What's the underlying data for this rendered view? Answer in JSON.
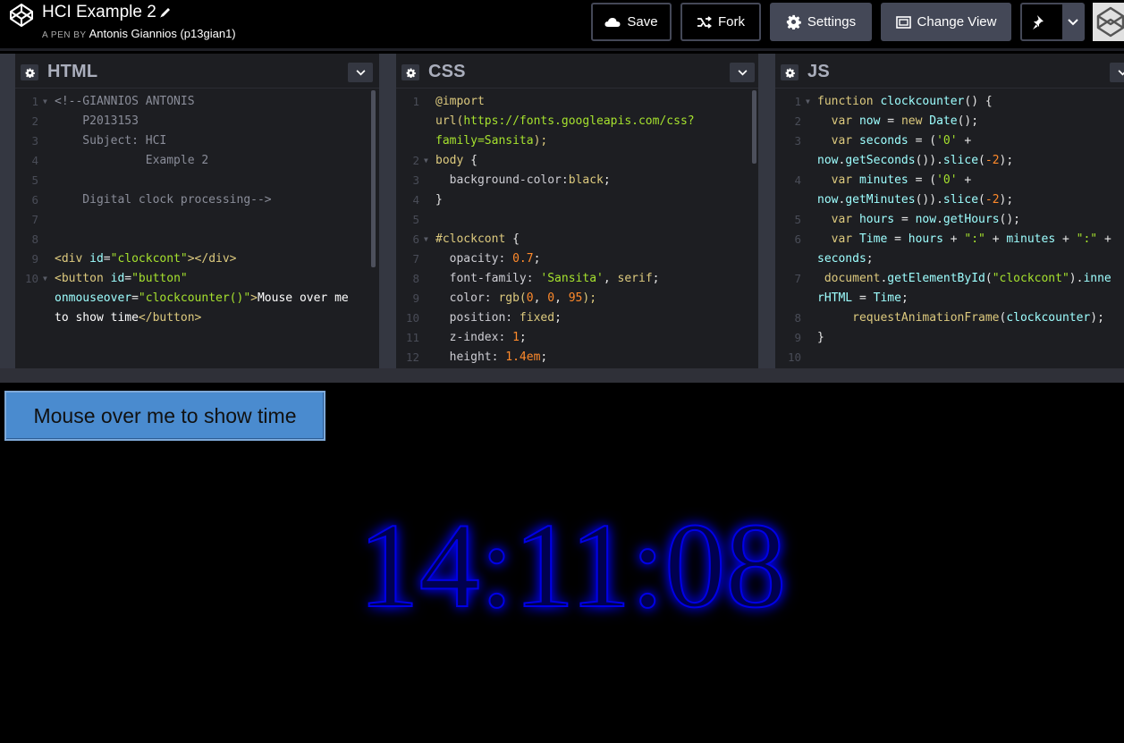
{
  "header": {
    "title": "HCI Example 2",
    "byline_prefix": "A PEN BY",
    "author": "Antonis Giannios (p13gian1)",
    "buttons": {
      "save": "Save",
      "fork": "Fork",
      "settings": "Settings",
      "change_view": "Change View"
    }
  },
  "editors": {
    "html": {
      "title": "HTML",
      "lines": [
        {
          "n": "1",
          "fold": true,
          "segments": [
            {
              "t": "<!--GIANNIOS ANTONIS",
              "c": "#8a8d99"
            }
          ]
        },
        {
          "n": "2",
          "segments": [
            {
              "t": "    P2013153",
              "c": "#8a8d99"
            }
          ]
        },
        {
          "n": "3",
          "segments": [
            {
              "t": "    Subject: HCI",
              "c": "#8a8d99"
            }
          ]
        },
        {
          "n": "4",
          "segments": [
            {
              "t": "             Example 2",
              "c": "#8a8d99"
            }
          ]
        },
        {
          "n": "5",
          "segments": [
            {
              "t": "",
              "c": "#8a8d99"
            }
          ]
        },
        {
          "n": "6",
          "segments": [
            {
              "t": "    Digital clock processing-->",
              "c": "#8a8d99"
            }
          ]
        },
        {
          "n": "7",
          "segments": []
        },
        {
          "n": "8",
          "segments": []
        },
        {
          "n": "9",
          "segments": [
            {
              "t": "<div ",
              "c": "#ddca7e"
            },
            {
              "t": "id",
              "c": "#9effff"
            },
            {
              "t": "=",
              "c": "#e6e6e6"
            },
            {
              "t": "\"clockcont\"",
              "c": "#a6e22e"
            },
            {
              "t": "></div>",
              "c": "#ddca7e"
            }
          ]
        },
        {
          "n": "10",
          "fold": true,
          "segments": [
            {
              "t": "<button ",
              "c": "#ddca7e"
            },
            {
              "t": "id",
              "c": "#9effff"
            },
            {
              "t": "=",
              "c": "#e6e6e6"
            },
            {
              "t": "\"button\"",
              "c": "#a6e22e"
            }
          ]
        },
        {
          "n": "",
          "segments": [
            {
              "t": "onmouseover",
              "c": "#9effff"
            },
            {
              "t": "=",
              "c": "#e6e6e6"
            },
            {
              "t": "\"clockcounter()\"",
              "c": "#a6e22e"
            },
            {
              "t": ">",
              "c": "#ddca7e"
            },
            {
              "t": "Mouse over me",
              "c": "#ffffff"
            }
          ]
        },
        {
          "n": "",
          "segments": [
            {
              "t": "to show time",
              "c": "#ffffff"
            },
            {
              "t": "</button>",
              "c": "#ddca7e"
            }
          ]
        }
      ]
    },
    "css": {
      "title": "CSS",
      "lines": [
        {
          "n": "1",
          "segments": [
            {
              "t": "@import",
              "c": "#ddca7e"
            }
          ]
        },
        {
          "n": "",
          "segments": [
            {
              "t": "url(",
              "c": "#ddca7e"
            },
            {
              "t": "https://fonts.googleapis.com/css?",
              "c": "#a6e22e"
            }
          ]
        },
        {
          "n": "",
          "segments": [
            {
              "t": "family=Sansita",
              "c": "#a6e22e"
            },
            {
              "t": ");",
              "c": "#ddca7e"
            }
          ]
        },
        {
          "n": "2",
          "fold": true,
          "segments": [
            {
              "t": "body ",
              "c": "#ddca7e"
            },
            {
              "t": "{",
              "c": "#e6e6e6"
            }
          ]
        },
        {
          "n": "3",
          "segments": [
            {
              "t": "  background-color:",
              "c": "#cdcdd3"
            },
            {
              "t": "black",
              "c": "#ddca7e"
            },
            {
              "t": ";",
              "c": "#e6e6e6"
            }
          ]
        },
        {
          "n": "4",
          "segments": [
            {
              "t": "}",
              "c": "#e6e6e6"
            }
          ]
        },
        {
          "n": "5",
          "segments": []
        },
        {
          "n": "6",
          "fold": true,
          "segments": [
            {
              "t": "#clockcont ",
              "c": "#ddca7e"
            },
            {
              "t": "{",
              "c": "#e6e6e6"
            }
          ]
        },
        {
          "n": "7",
          "segments": [
            {
              "t": "  opacity: ",
              "c": "#cdcdd3"
            },
            {
              "t": "0.7",
              "c": "#ff8a2b"
            },
            {
              "t": ";",
              "c": "#e6e6e6"
            }
          ]
        },
        {
          "n": "8",
          "segments": [
            {
              "t": "  font-family: ",
              "c": "#cdcdd3"
            },
            {
              "t": "'Sansita'",
              "c": "#a6e22e"
            },
            {
              "t": ", ",
              "c": "#e6e6e6"
            },
            {
              "t": "serif",
              "c": "#ddca7e"
            },
            {
              "t": ";",
              "c": "#e6e6e6"
            }
          ]
        },
        {
          "n": "9",
          "segments": [
            {
              "t": "  color: ",
              "c": "#cdcdd3"
            },
            {
              "t": "rgb(",
              "c": "#ddca7e"
            },
            {
              "t": "0",
              "c": "#ff8a2b"
            },
            {
              "t": ", ",
              "c": "#e6e6e6"
            },
            {
              "t": "0",
              "c": "#ff8a2b"
            },
            {
              "t": ", ",
              "c": "#e6e6e6"
            },
            {
              "t": "95",
              "c": "#ff8a2b"
            },
            {
              "t": ");",
              "c": "#ddca7e"
            }
          ]
        },
        {
          "n": "10",
          "segments": [
            {
              "t": "  position: ",
              "c": "#cdcdd3"
            },
            {
              "t": "fixed",
              "c": "#ddca7e"
            },
            {
              "t": ";",
              "c": "#e6e6e6"
            }
          ]
        },
        {
          "n": "11",
          "segments": [
            {
              "t": "  z-index: ",
              "c": "#cdcdd3"
            },
            {
              "t": "1",
              "c": "#ff8a2b"
            },
            {
              "t": ";",
              "c": "#e6e6e6"
            }
          ]
        },
        {
          "n": "12",
          "segments": [
            {
              "t": "  height: ",
              "c": "#cdcdd3"
            },
            {
              "t": "1.4em",
              "c": "#ff8a2b"
            },
            {
              "t": ";",
              "c": "#e6e6e6"
            }
          ]
        }
      ]
    },
    "js": {
      "title": "JS",
      "lines": [
        {
          "n": "1",
          "fold": true,
          "segments": [
            {
              "t": "function ",
              "c": "#ddca7e"
            },
            {
              "t": "clockcounter",
              "c": "#9effff"
            },
            {
              "t": "() {",
              "c": "#e6e6e6"
            }
          ]
        },
        {
          "n": "2",
          "segments": [
            {
              "t": "  var ",
              "c": "#ddca7e"
            },
            {
              "t": "now ",
              "c": "#9effff"
            },
            {
              "t": "= ",
              "c": "#e6e6e6"
            },
            {
              "t": "new ",
              "c": "#ddca7e"
            },
            {
              "t": "Date",
              "c": "#9effff"
            },
            {
              "t": "();",
              "c": "#e6e6e6"
            }
          ]
        },
        {
          "n": "3",
          "segments": [
            {
              "t": "  var ",
              "c": "#ddca7e"
            },
            {
              "t": "seconds ",
              "c": "#9effff"
            },
            {
              "t": "= (",
              "c": "#e6e6e6"
            },
            {
              "t": "'0'",
              "c": "#a6e22e"
            },
            {
              "t": " +",
              "c": "#e6e6e6"
            }
          ]
        },
        {
          "n": "",
          "segments": [
            {
              "t": "now",
              "c": "#9effff"
            },
            {
              "t": ".",
              "c": "#e6e6e6"
            },
            {
              "t": "getSeconds",
              "c": "#9effff"
            },
            {
              "t": "()).",
              "c": "#e6e6e6"
            },
            {
              "t": "slice",
              "c": "#9effff"
            },
            {
              "t": "(",
              "c": "#e6e6e6"
            },
            {
              "t": "-2",
              "c": "#ff8a2b"
            },
            {
              "t": ");",
              "c": "#e6e6e6"
            }
          ]
        },
        {
          "n": "4",
          "segments": [
            {
              "t": "  var ",
              "c": "#ddca7e"
            },
            {
              "t": "minutes ",
              "c": "#9effff"
            },
            {
              "t": "= (",
              "c": "#e6e6e6"
            },
            {
              "t": "'0'",
              "c": "#a6e22e"
            },
            {
              "t": " +",
              "c": "#e6e6e6"
            }
          ]
        },
        {
          "n": "",
          "segments": [
            {
              "t": "now",
              "c": "#9effff"
            },
            {
              "t": ".",
              "c": "#e6e6e6"
            },
            {
              "t": "getMinutes",
              "c": "#9effff"
            },
            {
              "t": "()).",
              "c": "#e6e6e6"
            },
            {
              "t": "slice",
              "c": "#9effff"
            },
            {
              "t": "(",
              "c": "#e6e6e6"
            },
            {
              "t": "-2",
              "c": "#ff8a2b"
            },
            {
              "t": ");",
              "c": "#e6e6e6"
            }
          ]
        },
        {
          "n": "5",
          "segments": [
            {
              "t": "  var ",
              "c": "#ddca7e"
            },
            {
              "t": "hours ",
              "c": "#9effff"
            },
            {
              "t": "= ",
              "c": "#e6e6e6"
            },
            {
              "t": "now",
              "c": "#9effff"
            },
            {
              "t": ".",
              "c": "#e6e6e6"
            },
            {
              "t": "getHours",
              "c": "#9effff"
            },
            {
              "t": "();",
              "c": "#e6e6e6"
            }
          ]
        },
        {
          "n": "6",
          "segments": [
            {
              "t": "  var ",
              "c": "#ddca7e"
            },
            {
              "t": "Time ",
              "c": "#9effff"
            },
            {
              "t": "= ",
              "c": "#e6e6e6"
            },
            {
              "t": "hours ",
              "c": "#9effff"
            },
            {
              "t": "+ ",
              "c": "#e6e6e6"
            },
            {
              "t": "\":\"",
              "c": "#a6e22e"
            },
            {
              "t": " + ",
              "c": "#e6e6e6"
            },
            {
              "t": "minutes ",
              "c": "#9effff"
            },
            {
              "t": "+ ",
              "c": "#e6e6e6"
            },
            {
              "t": "\":\"",
              "c": "#a6e22e"
            },
            {
              "t": " +",
              "c": "#e6e6e6"
            }
          ]
        },
        {
          "n": "",
          "segments": [
            {
              "t": "seconds",
              "c": "#9effff"
            },
            {
              "t": ";",
              "c": "#e6e6e6"
            }
          ]
        },
        {
          "n": "7",
          "segments": [
            {
              "t": " document",
              "c": "#ddca7e"
            },
            {
              "t": ".",
              "c": "#e6e6e6"
            },
            {
              "t": "getElementById",
              "c": "#9effff"
            },
            {
              "t": "(",
              "c": "#e6e6e6"
            },
            {
              "t": "\"clockcont\"",
              "c": "#a6e22e"
            },
            {
              "t": ").",
              "c": "#e6e6e6"
            },
            {
              "t": "inne",
              "c": "#9effff"
            }
          ]
        },
        {
          "n": "",
          "segments": [
            {
              "t": "rHTML ",
              "c": "#9effff"
            },
            {
              "t": "= ",
              "c": "#e6e6e6"
            },
            {
              "t": "Time",
              "c": "#9effff"
            },
            {
              "t": ";",
              "c": "#e6e6e6"
            }
          ]
        },
        {
          "n": "8",
          "segments": [
            {
              "t": "     requestAnimationFrame",
              "c": "#ddca7e"
            },
            {
              "t": "(",
              "c": "#e6e6e6"
            },
            {
              "t": "clockcounter",
              "c": "#9effff"
            },
            {
              "t": ");",
              "c": "#e6e6e6"
            }
          ]
        },
        {
          "n": "9",
          "segments": [
            {
              "t": "}",
              "c": "#e6e6e6"
            }
          ]
        },
        {
          "n": "10",
          "segments": []
        }
      ]
    }
  },
  "output": {
    "button_label": "Mouse over me to show time",
    "clock_time": "14:11:08"
  }
}
